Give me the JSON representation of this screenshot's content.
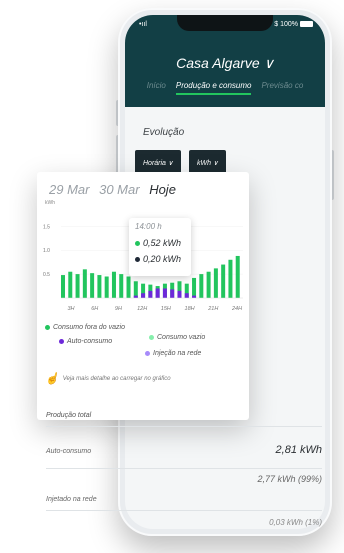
{
  "status": {
    "carrier": "•ııl",
    "battery": "$ 100%"
  },
  "header": {
    "title": "Casa Algarve ∨",
    "tabs": [
      "Início",
      "Produção e consumo",
      "Previsão co"
    ]
  },
  "evolution": {
    "label": "Evolução",
    "period_select": "Horária ∨",
    "unit_select": "kWh ∨"
  },
  "card": {
    "dates": [
      "29 Mar",
      "30 Mar",
      "Hoje"
    ],
    "unit_label": "kWh",
    "tooltip": {
      "time": "14:00 h",
      "green_value": "0,52 kWh",
      "dark_value": "0,20 kWh"
    },
    "legend": [
      "Consumo fora do vazio",
      "Consumo vazio",
      "Auto-consumo",
      "Injeção na rede"
    ],
    "hint": "Veja mais detalhe ao carregar no gráfico"
  },
  "colors": {
    "header": "#123f45",
    "green": "#22c55e",
    "light_green": "#86efac",
    "purple": "#6d28d9",
    "light_purple": "#a78bfa"
  },
  "chart_data": {
    "type": "bar",
    "x_ticks": [
      "3H",
      "6H",
      "9H",
      "12H",
      "15H",
      "18H",
      "21H",
      "24H"
    ],
    "y_ticks": [
      "1.5",
      "1.0",
      "0.5"
    ],
    "ylim": [
      0,
      1.8
    ],
    "series": [
      {
        "name": "Consumo fora do vazio",
        "values": [
          0.48,
          0.55,
          0.5,
          0.6,
          0.52,
          0.48,
          0.45,
          0.55,
          0.5,
          0.45,
          0.35,
          0.3,
          0.28,
          0.25,
          0.3,
          0.32,
          0.35,
          0.3,
          0.42,
          0.5,
          0.55,
          0.62,
          0.7,
          0.8,
          0.88
        ]
      },
      {
        "name": "Auto-consumo",
        "values": [
          0,
          0,
          0,
          0,
          0,
          0,
          0,
          0,
          0,
          0,
          0.05,
          0.1,
          0.15,
          0.2,
          0.2,
          0.18,
          0.15,
          0.1,
          0.05,
          0,
          0,
          0,
          0,
          0,
          0
        ]
      }
    ]
  },
  "summary": {
    "heading": "Produção total",
    "rows": [
      {
        "label": "Auto-consumo",
        "value": "2,81 kWh"
      },
      {
        "label": "",
        "value": "2,77 kWh (99%)"
      },
      {
        "label": "Injetado na rede",
        "value": "0,03 kWh (1%)"
      }
    ]
  }
}
